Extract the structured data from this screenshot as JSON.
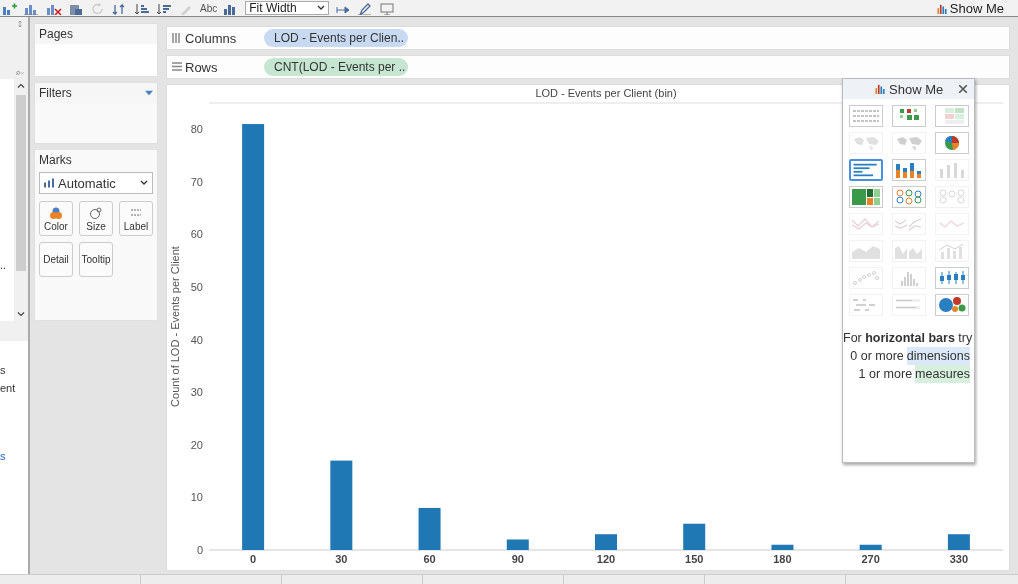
{
  "toolbar": {
    "items": [
      {
        "kind": "add-data",
        "disabled": false
      },
      {
        "kind": "new-chart",
        "disabled": false
      },
      {
        "kind": "clear-chart",
        "disabled": false
      },
      {
        "kind": "duplicate",
        "disabled": false
      },
      {
        "kind": "refresh",
        "disabled": true
      },
      {
        "kind": "swap",
        "disabled": false
      },
      {
        "kind": "sort-asc",
        "disabled": false
      },
      {
        "kind": "sort-desc",
        "disabled": false
      },
      {
        "kind": "highlight",
        "disabled": true
      },
      {
        "kind": "text",
        "label": "Abc",
        "disabled": false
      },
      {
        "kind": "chart-type",
        "disabled": false
      },
      {
        "kind": "select",
        "label": "Fit Width",
        "disabled": false
      },
      {
        "kind": "pin",
        "disabled": false
      },
      {
        "kind": "pencil",
        "disabled": false
      },
      {
        "kind": "presentation",
        "disabled": false
      }
    ],
    "show_me_button": "Show Me"
  },
  "data_pane": {
    "fragments": [
      {
        "text": "..",
        "kind": "overflow"
      },
      {
        "text": "s",
        "kind": "plain"
      },
      {
        "text": "ent",
        "kind": "plain"
      },
      {
        "text": "s",
        "kind": "link"
      }
    ]
  },
  "pages": {
    "title": "Pages"
  },
  "filters": {
    "title": "Filters"
  },
  "marks": {
    "title": "Marks",
    "mark_type": "Automatic",
    "buttons": [
      {
        "label": "Color",
        "kind": "color"
      },
      {
        "label": "Size",
        "kind": "size"
      },
      {
        "label": "Label",
        "kind": "label"
      },
      {
        "label": "Detail",
        "kind": "plain"
      },
      {
        "label": "Tooltip",
        "kind": "plain"
      }
    ]
  },
  "shelves": [
    {
      "label": "Columns",
      "kind": "columns",
      "pill": {
        "text": "LOD - Events per Clien..",
        "kind": "dimension"
      }
    },
    {
      "label": "Rows",
      "kind": "rows",
      "pill": {
        "text": "CNT(LOD - Events per ..",
        "kind": "measure"
      }
    }
  ],
  "chart": {
    "chart_data": {
      "type": "bar",
      "title": "LOD - Events per Client (bin)",
      "ylabel": "Count of LOD - Events per Client",
      "categories": [
        "0",
        "30",
        "60",
        "90",
        "120",
        "150",
        "180",
        "270",
        "330"
      ],
      "series": [
        {
          "color": "#1f77b4",
          "values": [
            81,
            17,
            8,
            2,
            3,
            5,
            1,
            1,
            3
          ]
        }
      ],
      "ylim": [
        0,
        85
      ],
      "yticks": [
        0,
        10,
        20,
        30,
        40,
        50,
        60,
        70,
        80
      ]
    }
  },
  "show_me": {
    "title": "Show Me",
    "charts": [
      {
        "kind": "text-table",
        "enabled": true,
        "selected": false
      },
      {
        "kind": "heat-map",
        "enabled": true,
        "selected": false
      },
      {
        "kind": "highlight-table",
        "enabled": true,
        "selected": false
      },
      {
        "kind": "symbol-map",
        "enabled": false,
        "selected": false
      },
      {
        "kind": "filled-map",
        "enabled": false,
        "selected": false
      },
      {
        "kind": "pie",
        "enabled": true,
        "selected": false
      },
      {
        "kind": "horizontal-bars",
        "enabled": true,
        "selected": true
      },
      {
        "kind": "stacked-bars",
        "enabled": true,
        "selected": false
      },
      {
        "kind": "side-by-side-bars",
        "enabled": false,
        "selected": false
      },
      {
        "kind": "treemap",
        "enabled": true,
        "selected": false
      },
      {
        "kind": "circles",
        "enabled": true,
        "selected": false
      },
      {
        "kind": "side-by-side-circles",
        "enabled": false,
        "selected": false
      },
      {
        "kind": "lines",
        "enabled": false,
        "selected": false
      },
      {
        "kind": "lines-discrete",
        "enabled": false,
        "selected": false
      },
      {
        "kind": "dual-lines",
        "enabled": false,
        "selected": false
      },
      {
        "kind": "area",
        "enabled": false,
        "selected": false
      },
      {
        "kind": "area-discrete",
        "enabled": false,
        "selected": false
      },
      {
        "kind": "dual-combination",
        "enabled": false,
        "selected": false
      },
      {
        "kind": "scatter",
        "enabled": false,
        "selected": false
      },
      {
        "kind": "histogram",
        "enabled": false,
        "selected": false
      },
      {
        "kind": "box-plot",
        "enabled": true,
        "selected": false
      },
      {
        "kind": "gantt",
        "enabled": false,
        "selected": false
      },
      {
        "kind": "bullet",
        "enabled": false,
        "selected": false
      },
      {
        "kind": "bubbles",
        "enabled": true,
        "selected": false
      }
    ],
    "hint": "For **horizontal bars** try",
    "requirements": [
      {
        "count": "0 or more",
        "field": "dimensions",
        "kind": "dimension"
      },
      {
        "count": "1 or more",
        "field": "measures",
        "kind": "measure"
      }
    ]
  }
}
